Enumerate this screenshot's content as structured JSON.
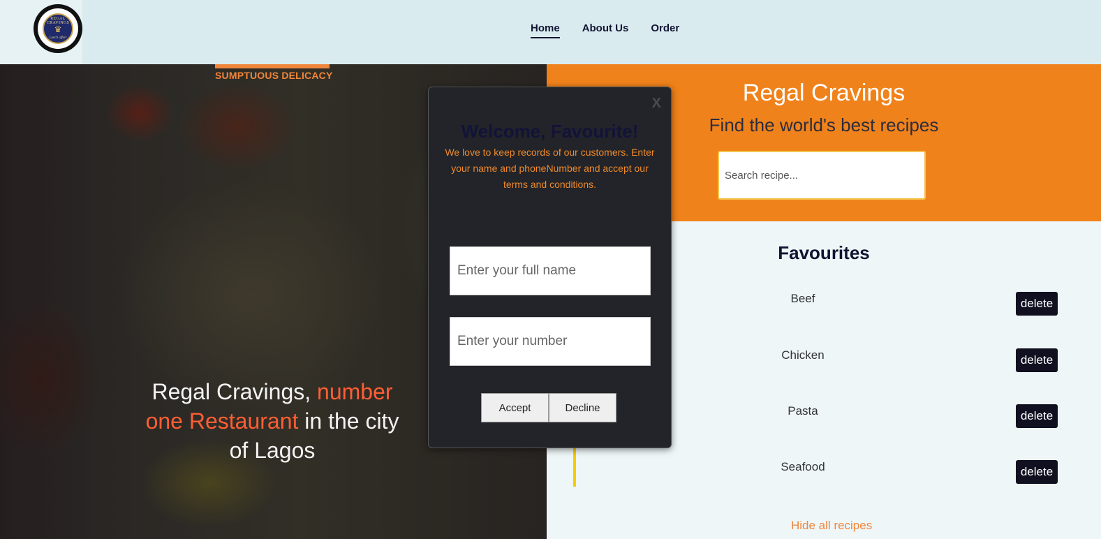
{
  "header": {
    "logo": {
      "text_top": "REGAL CRAVINGS",
      "text_bottom": "Lunch affair"
    },
    "nav": [
      {
        "label": "Home",
        "active": true
      },
      {
        "label": "About Us",
        "active": false
      },
      {
        "label": "Order",
        "active": false
      }
    ]
  },
  "hero": {
    "tag": "SUMPTUOUS DELICACY",
    "text_part1": "Regal Cravings, ",
    "text_highlight": "number one Restaurant",
    "text_part2": " in the city of Lagos"
  },
  "search_panel": {
    "title": "Regal Cravings",
    "subtitle": "Find the world's best recipes",
    "search_placeholder": "Search recipe..."
  },
  "favourites": {
    "title": "Favourites",
    "delete_label": "delete",
    "items": [
      {
        "name": "Beef"
      },
      {
        "name": "Chicken"
      },
      {
        "name": "Pasta"
      },
      {
        "name": "Seafood"
      }
    ],
    "hide_label": "Hide all recipes"
  },
  "modal": {
    "close_label": "X",
    "title": "Welcome, Favourite!",
    "description": "We love to keep records of our customers. Enter your name and phoneNumber and accept our terms and conditions.",
    "name_placeholder": "Enter your full name",
    "number_placeholder": "Enter your number",
    "accept_label": "Accept",
    "decline_label": "Decline"
  },
  "colors": {
    "accent_orange": "#f0821b",
    "highlight_red": "#ff5e34",
    "dark_navy": "#101433",
    "modal_bg": "#222429"
  }
}
